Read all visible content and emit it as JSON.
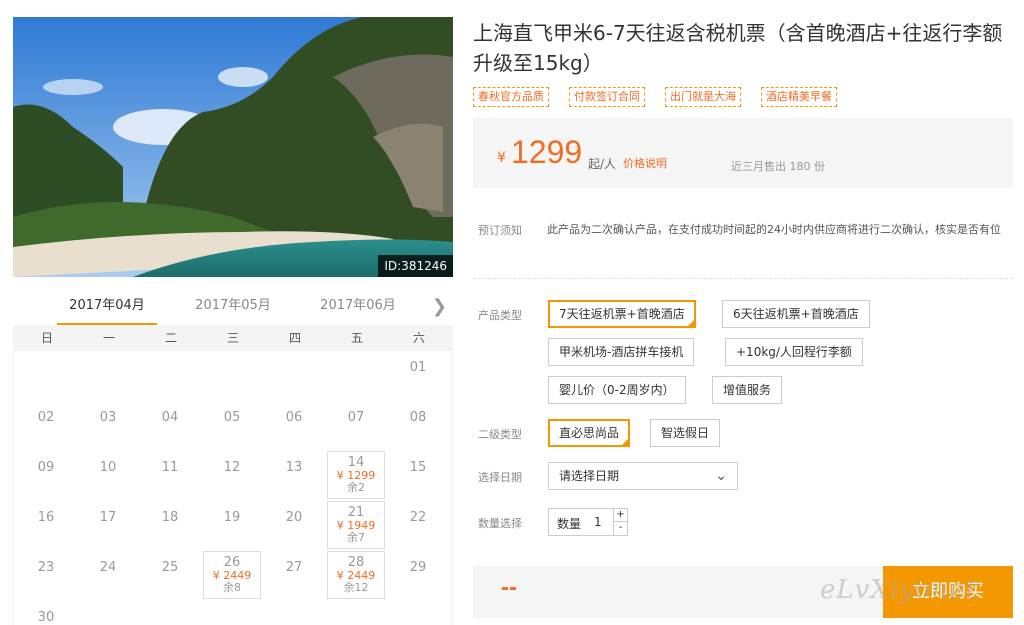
{
  "photo": {
    "id_label": "ID:381246"
  },
  "calendar": {
    "months": [
      "2017年04月",
      "2017年05月",
      "2017年06月"
    ],
    "active_month": 0,
    "weekdays": [
      "日",
      "一",
      "二",
      "三",
      "四",
      "五",
      "六"
    ],
    "next_icon": "chevron-right-icon",
    "days": [
      {
        "d": "01",
        "col": 6,
        "row": 0
      },
      {
        "d": "02",
        "col": 0,
        "row": 1
      },
      {
        "d": "03",
        "col": 1,
        "row": 1
      },
      {
        "d": "04",
        "col": 2,
        "row": 1
      },
      {
        "d": "05",
        "col": 3,
        "row": 1
      },
      {
        "d": "06",
        "col": 4,
        "row": 1
      },
      {
        "d": "07",
        "col": 5,
        "row": 1
      },
      {
        "d": "08",
        "col": 6,
        "row": 1
      },
      {
        "d": "09",
        "col": 0,
        "row": 2
      },
      {
        "d": "10",
        "col": 1,
        "row": 2
      },
      {
        "d": "11",
        "col": 2,
        "row": 2
      },
      {
        "d": "12",
        "col": 3,
        "row": 2
      },
      {
        "d": "13",
        "col": 4,
        "row": 2
      },
      {
        "d": "14",
        "col": 5,
        "row": 2,
        "price": "¥ 1299",
        "stock": "余2"
      },
      {
        "d": "15",
        "col": 6,
        "row": 2
      },
      {
        "d": "16",
        "col": 0,
        "row": 3
      },
      {
        "d": "17",
        "col": 1,
        "row": 3
      },
      {
        "d": "18",
        "col": 2,
        "row": 3
      },
      {
        "d": "19",
        "col": 3,
        "row": 3
      },
      {
        "d": "20",
        "col": 4,
        "row": 3
      },
      {
        "d": "21",
        "col": 5,
        "row": 3,
        "price": "¥ 1949",
        "stock": "余7"
      },
      {
        "d": "22",
        "col": 6,
        "row": 3
      },
      {
        "d": "23",
        "col": 0,
        "row": 4
      },
      {
        "d": "24",
        "col": 1,
        "row": 4
      },
      {
        "d": "25",
        "col": 2,
        "row": 4
      },
      {
        "d": "26",
        "col": 3,
        "row": 4,
        "price": "¥ 2449",
        "stock": "余8"
      },
      {
        "d": "27",
        "col": 4,
        "row": 4
      },
      {
        "d": "28",
        "col": 5,
        "row": 4,
        "price": "¥ 2449",
        "stock": "余12"
      },
      {
        "d": "29",
        "col": 6,
        "row": 4
      },
      {
        "d": "30",
        "col": 0,
        "row": 5
      }
    ]
  },
  "product": {
    "title": "上海直飞甲米6-7天往返含税机票（含首晚酒店+往返行李额升级至15kg）",
    "tags": [
      "春秋官方品质",
      "付款签订合同",
      "出门就是大海",
      "酒店精美早餐"
    ],
    "price": {
      "currency": "¥",
      "amount": "1299",
      "per": "起/人",
      "explain": "价格说明",
      "sold": "近三月售出 180 份"
    },
    "notice": {
      "label": "预订须知",
      "text": "此产品为二次确认产品，在支付成功时间起的24小时内供应商将进行二次确认，核实是否有位"
    },
    "product_type": {
      "label": "产品类型",
      "options": [
        "7天往返机票+首晚酒店",
        "6天往返机票+首晚酒店",
        "甲米机场-酒店拼车接机",
        "+10kg/人回程行李额",
        "婴儿价（0-2周岁内）",
        "增值服务"
      ],
      "selected": 0
    },
    "sub_type": {
      "label": "二级类型",
      "options": [
        "直必思尚品",
        "智选假日"
      ],
      "selected": 0
    },
    "date": {
      "label": "选择日期",
      "value": "请选择日期",
      "icon": "chevron-down-icon"
    },
    "quantity": {
      "label": "数量选择",
      "field_label": "数量",
      "value": "1",
      "plus": "+",
      "minus": "-"
    },
    "total": "--",
    "buy_label": "立即购买",
    "watermark": "eLvXiyonet"
  }
}
